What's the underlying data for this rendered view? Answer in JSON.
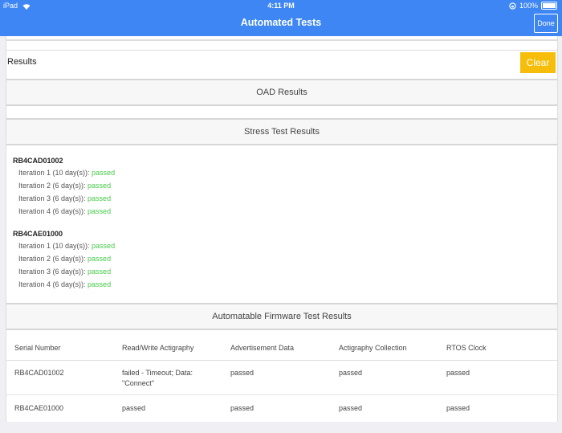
{
  "status_bar": {
    "carrier": "iPad",
    "time": "4:11 PM",
    "battery": "100%"
  },
  "nav": {
    "title": "Automated Tests",
    "done_label": "Done"
  },
  "results": {
    "label": "Results",
    "clear_label": "Clear"
  },
  "sections": {
    "oad": "OAD Results",
    "stress": "Stress Test Results",
    "firmware": "Automatable Firmware Test Results"
  },
  "stress_devices": [
    {
      "serial": "RB4CAD01002",
      "iterations": [
        {
          "label": "Iteration 1 (10 day(s)): ",
          "result": "passed"
        },
        {
          "label": "Iteration 2 (6 day(s)): ",
          "result": "passed"
        },
        {
          "label": "Iteration 3 (6 day(s)): ",
          "result": "passed"
        },
        {
          "label": "Iteration 4 (6 day(s)): ",
          "result": "passed"
        }
      ]
    },
    {
      "serial": "RB4CAE01000",
      "iterations": [
        {
          "label": "Iteration 1 (10 day(s)): ",
          "result": "passed"
        },
        {
          "label": "Iteration 2 (6 day(s)): ",
          "result": "passed"
        },
        {
          "label": "Iteration 3 (6 day(s)): ",
          "result": "passed"
        },
        {
          "label": "Iteration 4 (6 day(s)): ",
          "result": "passed"
        }
      ]
    }
  ],
  "firmware_table": {
    "headers": [
      "Serial Number",
      "Read/Write Actigraphy",
      "Advertisement Data",
      "Actigraphy Collection",
      "RTOS Clock"
    ],
    "rows": [
      [
        "RB4CAD01002",
        "failed - Timeout; Data: \"Connect\"",
        "passed",
        "passed",
        "passed"
      ],
      [
        "RB4CAE01000",
        "passed",
        "passed",
        "passed",
        "passed"
      ]
    ]
  },
  "colors": {
    "nav": "#3d86f4",
    "clear": "#f6be0b",
    "pass": "#47c94a",
    "fail": "#e8584a"
  }
}
